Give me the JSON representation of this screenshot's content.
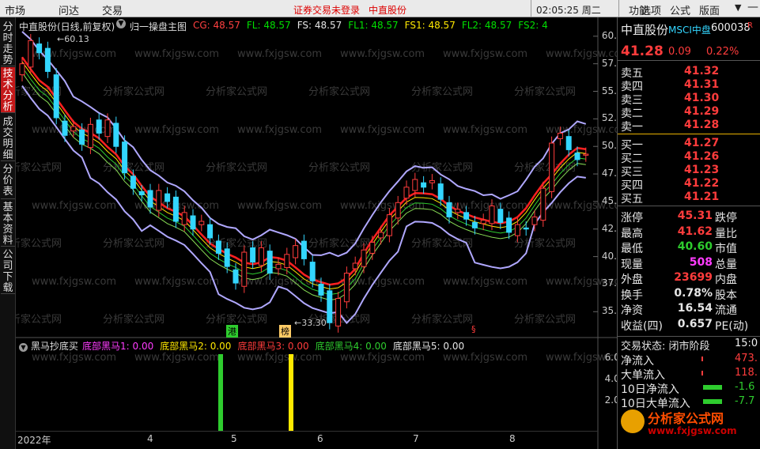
{
  "topbar": {
    "menus": [
      "市场",
      "问达",
      "交易"
    ],
    "warning": "证券交易未登录",
    "stock": "中直股份",
    "time": "02:05:25 周二",
    "right_menus": [
      "功能",
      "选项",
      "公式",
      "版面"
    ]
  },
  "side_tabs": [
    "分时走势",
    "技术分析",
    "成交明细",
    "分价表",
    "基本资料",
    "公司下载"
  ],
  "main_chart": {
    "title": "中直股份(日线,前复权)",
    "indicator": "归一操盘主图",
    "params": [
      {
        "text": "CG: 48.57",
        "color": "#ff4040"
      },
      {
        "text": "FL: 48.57",
        "color": "#00e000"
      },
      {
        "text": "FS: 48.57",
        "color": "#e6e6e6"
      },
      {
        "text": "FL1: 48.57",
        "color": "#00e000"
      },
      {
        "text": "FS1: 48.57",
        "color": "#ffe900"
      },
      {
        "text": "FL2: 48.57",
        "color": "#00e000"
      },
      {
        "text": "FS2: 4",
        "color": "#00e000"
      }
    ],
    "high_label": "60.13",
    "low_label": "33.30",
    "markers": [
      "港",
      "榜"
    ],
    "y_ticks": [
      "60.00",
      "57.50",
      "55.00",
      "52.50",
      "50.00",
      "47.50",
      "45.00",
      "42.50",
      "40.00",
      "37.50",
      "35.00"
    ]
  },
  "chart_data": [
    {
      "type": "candlestick",
      "title": "中直股份(日线,前复权)",
      "ylim": [
        33.3,
        60.13
      ],
      "approx_close": [
        57.5,
        59.6,
        58.5,
        56.8,
        52.6,
        51.0,
        51.8,
        50.2,
        52.0,
        51.2,
        52.4,
        50.0,
        47.6,
        46.2,
        45.6,
        44.5,
        46.0,
        45.0,
        43.2,
        44.0,
        42.5,
        43.2,
        41.7,
        40.3,
        39.1,
        37.6,
        40.4,
        39.5,
        40.8,
        38.5,
        39.3,
        40.2,
        41.0,
        39.8,
        37.8,
        36.5,
        34.0,
        36.2,
        38.5,
        39.4,
        40.6,
        41.3,
        42.2,
        43.8,
        44.9,
        46.3,
        47.0,
        46.3,
        46.9,
        45.2,
        43.6,
        44.3,
        43.4,
        42.6,
        43.3,
        44.6,
        43.1,
        42.2,
        42.9,
        42.5,
        43.6,
        46.2,
        50.3,
        51.2,
        49.7,
        48.8,
        49.3
      ]
    },
    {
      "type": "bar",
      "title": "黑马抄底买",
      "series": [
        {
          "name": "底部黑马1",
          "value": 0.0
        },
        {
          "name": "底部黑马2",
          "value": 0.0
        },
        {
          "name": "底部黑马3",
          "value": 0.0
        },
        {
          "name": "底部黑马4",
          "value": 0.0
        },
        {
          "name": "底部黑马5",
          "value": 0.0
        }
      ],
      "y_ticks": [
        "6.00",
        "4.00",
        "2.00"
      ]
    }
  ],
  "sub_chart": {
    "title": "黑马抄底买",
    "items": [
      {
        "text": "底部黑马1: 0.00",
        "color": "#ff3cff"
      },
      {
        "text": "底部黑马2: 0.00",
        "color": "#ffe900"
      },
      {
        "text": "底部黑马3: 0.00",
        "color": "#ff3c3c"
      },
      {
        "text": "底部黑马4: 0.00",
        "color": "#2ecc2e"
      },
      {
        "text": "底部黑马5: 0.00",
        "color": "#e6e6e6"
      }
    ],
    "y_ticks": [
      "6.00",
      "4.00",
      "2.00"
    ]
  },
  "x_axis": [
    "2022年",
    "4",
    "5",
    "6",
    "7",
    "8"
  ],
  "quote": {
    "name": "中直股份",
    "tag": "MSCI中盘",
    "code": "600038",
    "price": "41.28",
    "change": "0.09",
    "pct": "0.22%",
    "sells": [
      {
        "label": "卖五",
        "price": "41.32"
      },
      {
        "label": "卖四",
        "price": "41.31"
      },
      {
        "label": "卖三",
        "price": "41.30"
      },
      {
        "label": "卖二",
        "price": "41.29"
      },
      {
        "label": "卖一",
        "price": "41.28"
      }
    ],
    "buys": [
      {
        "label": "买一",
        "price": "41.27"
      },
      {
        "label": "买二",
        "price": "41.26"
      },
      {
        "label": "买三",
        "price": "41.23"
      },
      {
        "label": "买四",
        "price": "41.22"
      },
      {
        "label": "买五",
        "price": "41.21"
      }
    ],
    "stats": [
      {
        "label": "涨停",
        "value": "45.31",
        "right": "跌停",
        "color": "#ff3c3c"
      },
      {
        "label": "最高",
        "value": "41.62",
        "right": "量比",
        "color": "#ff3c3c"
      },
      {
        "label": "最低",
        "value": "40.60",
        "right": "市值",
        "color": "#2ecc2e"
      },
      {
        "label": "现量",
        "value": "508",
        "right": "总量",
        "color": "#ff3cff"
      },
      {
        "label": "外盘",
        "value": "23699",
        "right": "内盘",
        "color": "#ff3c3c"
      },
      {
        "label": "换手",
        "value": "0.78%",
        "right": "股本",
        "color": "#e6e6e6"
      },
      {
        "label": "净资",
        "value": "16.54",
        "right": "流通",
        "color": "#e6e6e6"
      },
      {
        "label": "收益(四)",
        "value": "0.657",
        "right": "PE(动)",
        "color": "#e6e6e6"
      }
    ],
    "trade_status": "交易状态: 闭市阶段",
    "trade_time": "15:0",
    "flows": [
      {
        "label": "净流入",
        "value": "473.",
        "color": "#ff3c3c"
      },
      {
        "label": "大单流入",
        "value": "118.",
        "color": "#ff3c3c"
      },
      {
        "label": "10日净流入",
        "value": "-1.6",
        "color": "#2ecc2e"
      },
      {
        "label": "10日大单流入",
        "value": "-7.7",
        "color": "#2ecc2e"
      }
    ]
  },
  "watermark": "分析家公式网",
  "watermark_url": "www.fxjgsw.com",
  "colors": {
    "up": "#ff3c3c",
    "down": "#33d6ff",
    "cg": "#ff2020",
    "band": "#b0a8ff"
  }
}
